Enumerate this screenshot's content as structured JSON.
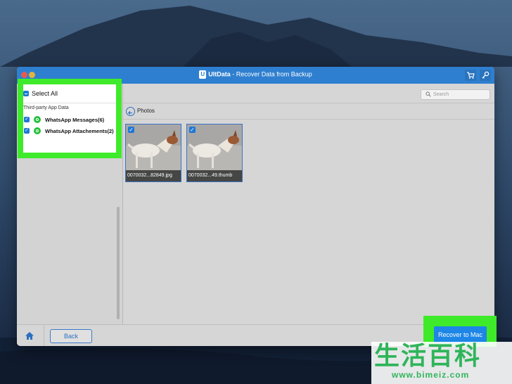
{
  "colors": {
    "accent": "#2f7fd0",
    "highlight": "#3eea29",
    "primary_button": "#1d86e6",
    "whatsapp": "#25c03b"
  },
  "window": {
    "app_name": "UltData",
    "title_rest": " - Recover Data from Backup",
    "cart_icon": "cart-icon",
    "key_icon": "key-icon"
  },
  "sidebar": {
    "select_all": "Select All",
    "category": "Third-party App Data",
    "items": [
      {
        "label": "WhatsApp Messages(6)",
        "checked": true,
        "icon": "whatsapp-icon"
      },
      {
        "label": "WhatsApp Attachements(2)",
        "checked": true,
        "icon": "whatsapp-icon"
      }
    ]
  },
  "main": {
    "search_placeholder": "Search",
    "breadcrumb": "Photos",
    "photos": [
      {
        "name": "0070032...82849.jpg",
        "checked": true
      },
      {
        "name": "0070032...49.thumb",
        "checked": true
      }
    ]
  },
  "footer": {
    "back_label": "Back",
    "recover_label": "Recover to Mac"
  },
  "watermark": {
    "chars": "生活百科",
    "url": "www.bimeiz.com"
  }
}
